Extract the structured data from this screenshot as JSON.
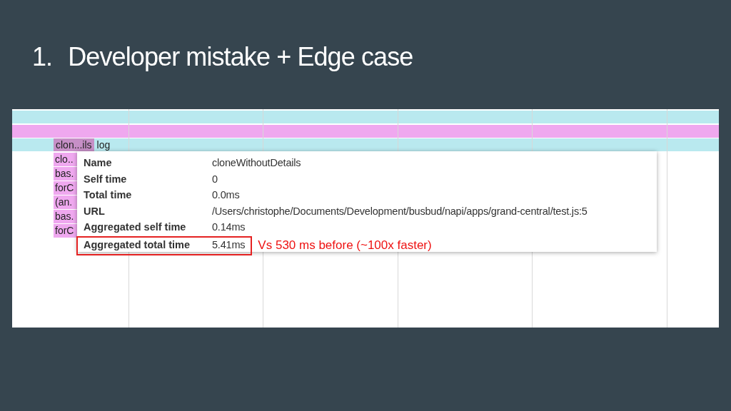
{
  "slide": {
    "number": "1.",
    "title": "Developer mistake + Edge case"
  },
  "flame_chart": {
    "top_blocks": [
      {
        "label": "clon...ils",
        "selected": true
      },
      {
        "label": "log",
        "selected": false
      }
    ],
    "stack_blocks": [
      "clo..",
      "bas.",
      "forC",
      "(an.",
      "bas.",
      "forC"
    ]
  },
  "tooltip": {
    "rows": [
      {
        "label": "Name",
        "value": "cloneWithoutDetails",
        "highlighted": false
      },
      {
        "label": "Self time",
        "value": "0",
        "highlighted": false
      },
      {
        "label": "Total time",
        "value": "0.0ms",
        "highlighted": false
      },
      {
        "label": "URL",
        "value": "/Users/christophe/Documents/Development/busbud/napi/apps/grand-central/test.js:5",
        "highlighted": false
      },
      {
        "label": "Aggregated self time",
        "value": "0.14ms",
        "highlighted": false
      },
      {
        "label": "Aggregated total time",
        "value": "5.41ms",
        "highlighted": true
      }
    ]
  },
  "annotation": "Vs 530 ms before (~100x faster)"
}
